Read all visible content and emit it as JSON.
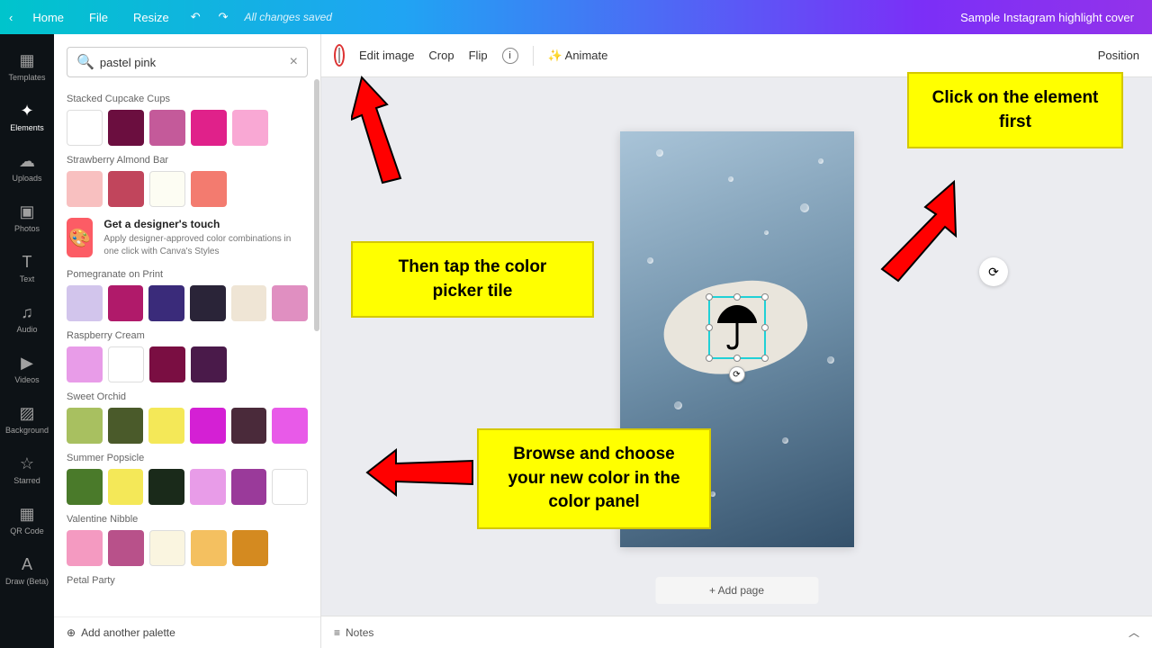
{
  "topbar": {
    "home": "Home",
    "file": "File",
    "resize": "Resize",
    "saved": "All changes saved",
    "doc_title": "Sample Instagram highlight cover"
  },
  "sidebar": {
    "items": [
      {
        "icon": "▦",
        "label": "Templates"
      },
      {
        "icon": "✦",
        "label": "Elements"
      },
      {
        "icon": "☁",
        "label": "Uploads"
      },
      {
        "icon": "▣",
        "label": "Photos"
      },
      {
        "icon": "T",
        "label": "Text"
      },
      {
        "icon": "♫",
        "label": "Audio"
      },
      {
        "icon": "▶",
        "label": "Videos"
      },
      {
        "icon": "▨",
        "label": "Background"
      },
      {
        "icon": "☆",
        "label": "Starred"
      },
      {
        "icon": "▦",
        "label": "QR Code"
      },
      {
        "icon": "A",
        "label": "Draw (Beta)"
      }
    ]
  },
  "search": {
    "value": "pastel pink"
  },
  "promo": {
    "title": "Get a designer's touch",
    "desc": "Apply designer-approved color combinations in one click with Canva's Styles"
  },
  "palettes": [
    {
      "name": "Stacked Cupcake Cups",
      "colors": [
        "#ffffff",
        "#6b0e3f",
        "#c45a9a",
        "#e0218a",
        "#f9a8d4"
      ]
    },
    {
      "name": "Strawberry Almond Bar",
      "colors": [
        "#f8c0c0",
        "#c1455c",
        "#fdfdf3",
        "#f37b6f"
      ]
    },
    {
      "name": "Pomegranate on Print",
      "colors": [
        "#d2c5ec",
        "#b01a6a",
        "#3a2b7a",
        "#2a2438",
        "#efe5d5",
        "#e08fc1"
      ]
    },
    {
      "name": "Raspberry Cream",
      "colors": [
        "#e89ce8",
        "#ffffff",
        "#7a0e42",
        "#4a1a4a"
      ]
    },
    {
      "name": "Sweet Orchid",
      "colors": [
        "#a8c060",
        "#4a5a2a",
        "#f4e858",
        "#d420d4",
        "#4a2a3a",
        "#e85ae8"
      ]
    },
    {
      "name": "Summer Popsicle",
      "colors": [
        "#4a7a2a",
        "#f4e858",
        "#1a2a1a",
        "#e89ce8",
        "#9a3a9a",
        "#ffffff"
      ]
    },
    {
      "name": "Valentine Nibble",
      "colors": [
        "#f49ac1",
        "#b8518a",
        "#faf5e0",
        "#f4c060",
        "#d48a20"
      ]
    },
    {
      "name": "Petal Party",
      "colors": []
    }
  ],
  "add_palette": "Add another palette",
  "toolbar": {
    "edit_image": "Edit image",
    "crop": "Crop",
    "flip": "Flip",
    "animate": "Animate",
    "position": "Position"
  },
  "canvas": {
    "add_page": "+ Add page"
  },
  "bottom": {
    "notes": "Notes"
  },
  "callouts": {
    "c1": "Click on the element first",
    "c2": "Then tap the color picker tile",
    "c3": "Browse and choose your new color in the color panel"
  }
}
